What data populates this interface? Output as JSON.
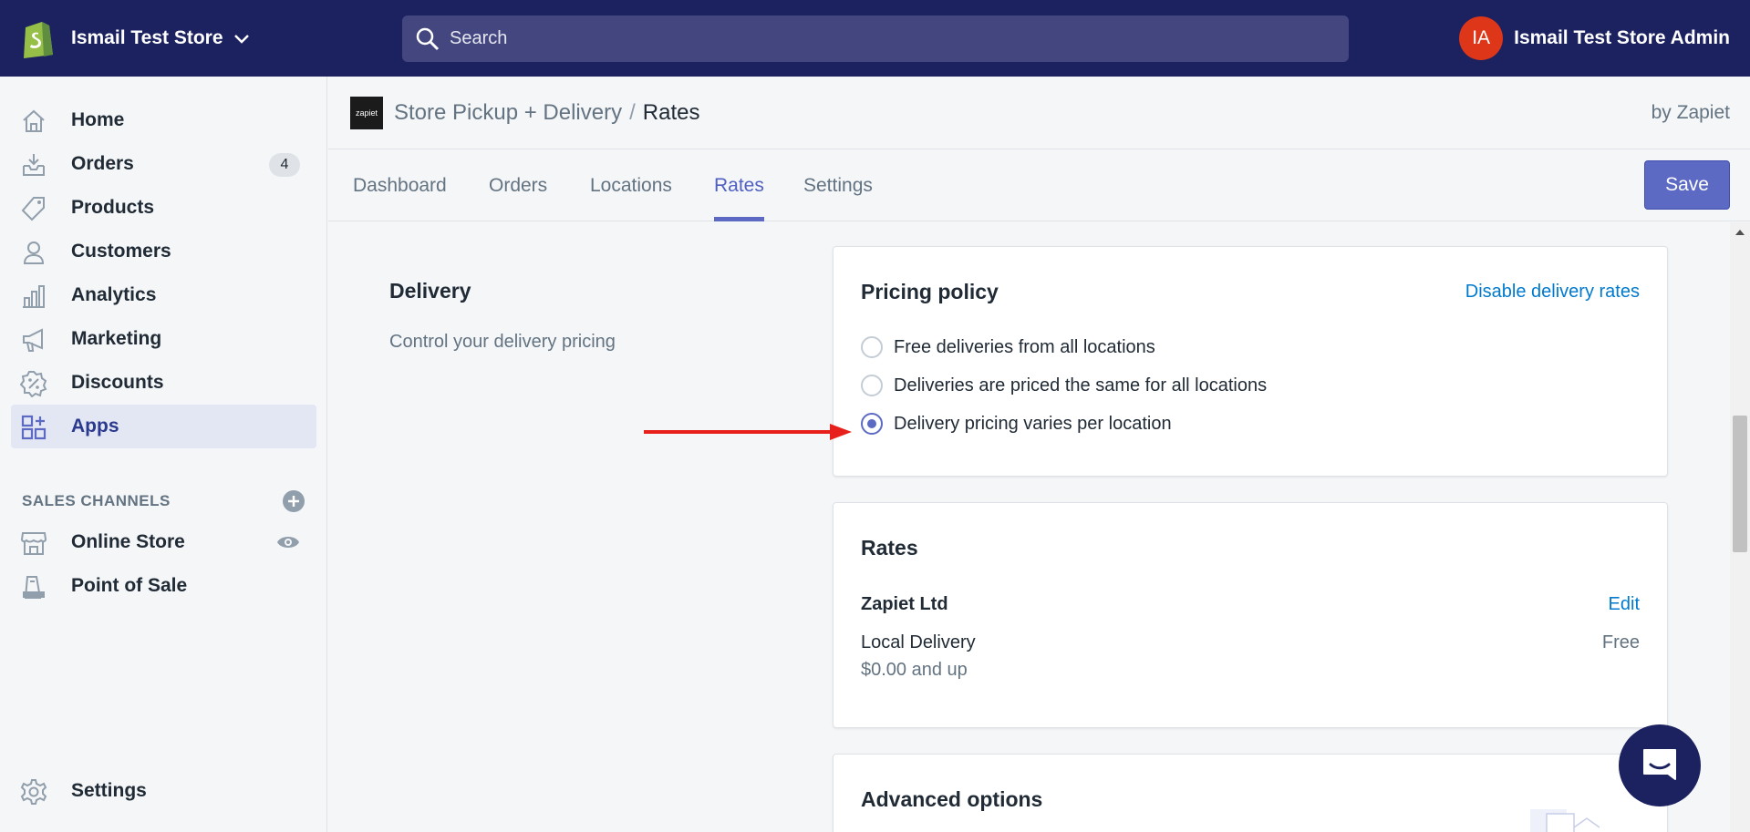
{
  "topbar": {
    "store_name": "Ismail Test Store",
    "search_placeholder": "Search",
    "avatar_initials": "IA",
    "account_name": "Ismail Test Store Admin"
  },
  "sidebar": {
    "items": [
      {
        "label": "Home",
        "icon": "home-icon"
      },
      {
        "label": "Orders",
        "icon": "orders-icon",
        "badge": "4"
      },
      {
        "label": "Products",
        "icon": "tag-icon"
      },
      {
        "label": "Customers",
        "icon": "customer-icon"
      },
      {
        "label": "Analytics",
        "icon": "analytics-icon"
      },
      {
        "label": "Marketing",
        "icon": "megaphone-icon"
      },
      {
        "label": "Discounts",
        "icon": "discount-icon"
      },
      {
        "label": "Apps",
        "icon": "apps-icon",
        "active": true
      }
    ],
    "sales_channels_label": "SALES CHANNELS",
    "channels": [
      {
        "label": "Online Store",
        "icon": "store-icon"
      },
      {
        "label": "Point of Sale",
        "icon": "pos-icon"
      }
    ],
    "settings_label": "Settings"
  },
  "app_header": {
    "logo_text": "zapiet",
    "app_name": "Store Pickup + Delivery",
    "separator": "/",
    "current_page": "Rates",
    "byline": "by Zapiet"
  },
  "tabs": [
    "Dashboard",
    "Orders",
    "Locations",
    "Rates",
    "Settings"
  ],
  "active_tab": "Rates",
  "save_label": "Save",
  "delivery": {
    "title": "Delivery",
    "description": "Control your delivery pricing"
  },
  "pricing_policy": {
    "title": "Pricing policy",
    "action": "Disable delivery rates",
    "options": [
      "Free deliveries from all locations",
      "Deliveries are priced the same for all locations",
      "Delivery pricing varies per location"
    ],
    "selected_index": 2
  },
  "rates": {
    "title": "Rates",
    "location": "Zapiet Ltd",
    "edit_label": "Edit",
    "rate_name": "Local Delivery",
    "rate_condition": "$0.00 and up",
    "rate_price": "Free"
  },
  "advanced": {
    "title": "Advanced options"
  },
  "colors": {
    "topbar": "#1c2260",
    "accent": "#5c6ac4",
    "link": "#007ace",
    "avatar": "#de3618",
    "arrow": "#e8201b"
  }
}
